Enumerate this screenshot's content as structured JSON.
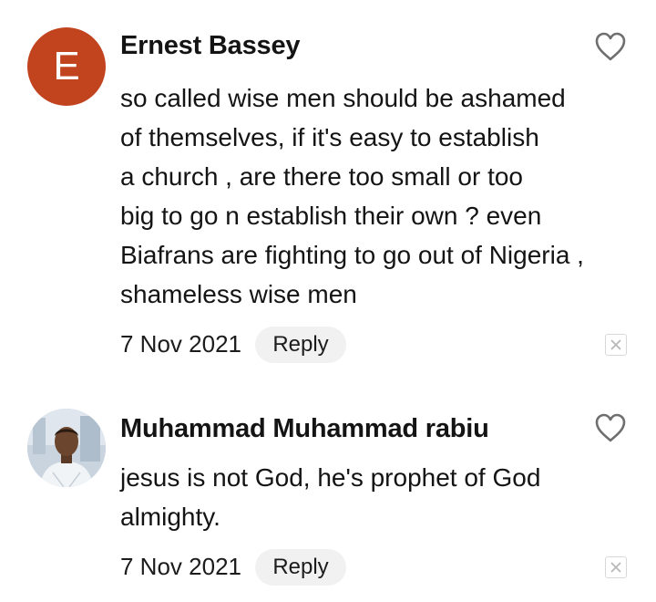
{
  "comments": [
    {
      "avatar_letter": "E",
      "avatar_color": "#c1441f",
      "author": "Ernest Bassey",
      "lines": [
        "so called wise men should be ashamed",
        "of themselves, if it's easy to establish",
        "a church , are there too small or too",
        "big to go n establish their own ? even",
        "Biafrans are fighting to go out of Nigeria ,",
        "shameless wise men"
      ],
      "date": "7 Nov 2021",
      "reply_label": "Reply",
      "like_icon": "heart-outline-icon",
      "close_icon": "close-icon"
    },
    {
      "avatar_type": "photo",
      "author": "Muhammad Muhammad rabiu",
      "lines": [
        "jesus is not God, he's prophet of God",
        "almighty."
      ],
      "date": "7 Nov 2021",
      "reply_label": "Reply",
      "like_icon": "heart-outline-icon",
      "close_icon": "close-icon"
    }
  ]
}
